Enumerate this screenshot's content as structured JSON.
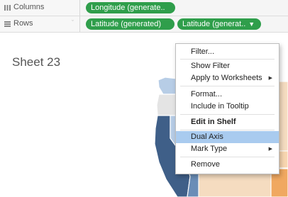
{
  "shelves": {
    "columns": {
      "label": "Columns",
      "icon": "columns-icon",
      "pills": [
        "Longitude (generate.."
      ]
    },
    "rows": {
      "label": "Rows",
      "icon": "rows-icon",
      "pills": [
        "Latitude (generated)",
        "Latitude (generat.."
      ]
    }
  },
  "sheet": {
    "title": "Sheet 23"
  },
  "context_menu": {
    "items": [
      "Filter...",
      "Show Filter",
      "Apply to Worksheets",
      "Format...",
      "Include in Tooltip",
      "Edit in Shelf",
      "Dual Axis",
      "Mark Type",
      "Remove"
    ],
    "highlighted": "Dual Axis",
    "submenu_items": [
      "Apply to Worksheets",
      "Mark Type"
    ]
  },
  "colors": {
    "pill_green": "#2f9e4b",
    "menu_highlight": "#a9cbef",
    "map_dark_blue": "#4d6f95",
    "map_light_blue": "#b7cde6",
    "map_orange": "#f0a860",
    "map_light_orange": "#f8d6b0"
  }
}
